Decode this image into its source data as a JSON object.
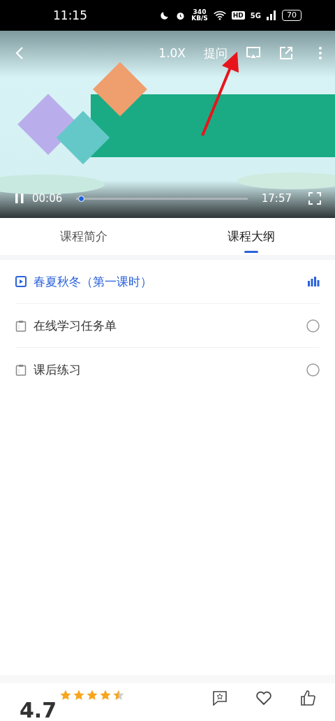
{
  "status_bar": {
    "time": "11:15",
    "speed": "340",
    "speed_unit": "KB/S",
    "hd": "HD",
    "network": "5G",
    "battery": "70"
  },
  "player": {
    "speed": "1.0X",
    "ask": "提问",
    "playing": true,
    "current": "00:06",
    "duration": "17:57",
    "level": 0.01
  },
  "tabs": [
    {
      "label": "课程简介",
      "selected": false
    },
    {
      "label": "课程大纲",
      "selected": true
    }
  ],
  "outline": [
    {
      "kind": "video",
      "title": "春夏秋冬（第一课时）",
      "selected": true
    },
    {
      "kind": "document",
      "title": "在线学习任务单",
      "selected": false
    },
    {
      "kind": "document",
      "title": "课后练习",
      "selected": false
    }
  ],
  "rating": {
    "score": "4.7",
    "stars": 4.5
  }
}
